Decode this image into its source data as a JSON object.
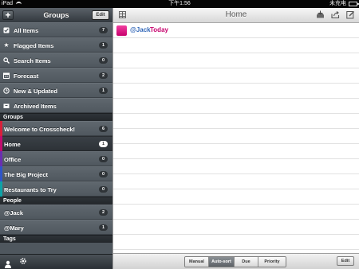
{
  "status_bar": {
    "device": "iPad",
    "time": "下午1:56",
    "battery": "未充电"
  },
  "sidebar": {
    "title": "Groups",
    "add_label": "+",
    "edit_label": "Edit",
    "items": [
      {
        "label": "All Items",
        "count": "7",
        "icon": "checkbox-icon"
      },
      {
        "label": "Flagged Items",
        "count": "1",
        "icon": "star-icon"
      },
      {
        "label": "Search Items",
        "count": "0",
        "icon": "search-icon"
      },
      {
        "label": "Forecast",
        "count": "2",
        "icon": "calendar-icon"
      },
      {
        "label": "New & Updated",
        "count": "1",
        "icon": "clock-icon"
      },
      {
        "label": "Archived Items",
        "count": "",
        "icon": "archive-icon"
      }
    ],
    "groups_header": "Groups",
    "groups": [
      {
        "label": "Welcome to Crosscheck!",
        "count": "6",
        "color": "#d8203a"
      },
      {
        "label": "Home",
        "count": "1",
        "color": "#c00c6e",
        "selected": true
      },
      {
        "label": "Office",
        "count": "0",
        "color": "#6a2fb0"
      },
      {
        "label": "The Big Project",
        "count": "0",
        "color": "#2f55c8"
      },
      {
        "label": "Restaurants to Try",
        "count": "0",
        "color": "#0ea2a6"
      }
    ],
    "people_header": "People",
    "people": [
      {
        "label": "@Jack",
        "count": "2"
      },
      {
        "label": "@Mary",
        "count": "1"
      }
    ],
    "tags_header": "Tags"
  },
  "main": {
    "title": "Home",
    "tasks": [
      {
        "person": "@Jack",
        "due": "Today",
        "color": "#d81b7f"
      }
    ],
    "sort_options": [
      "Manual",
      "Auto-sort",
      "Due",
      "Priority"
    ],
    "active_sort": "Auto-sort",
    "edit_label": "Edit"
  }
}
